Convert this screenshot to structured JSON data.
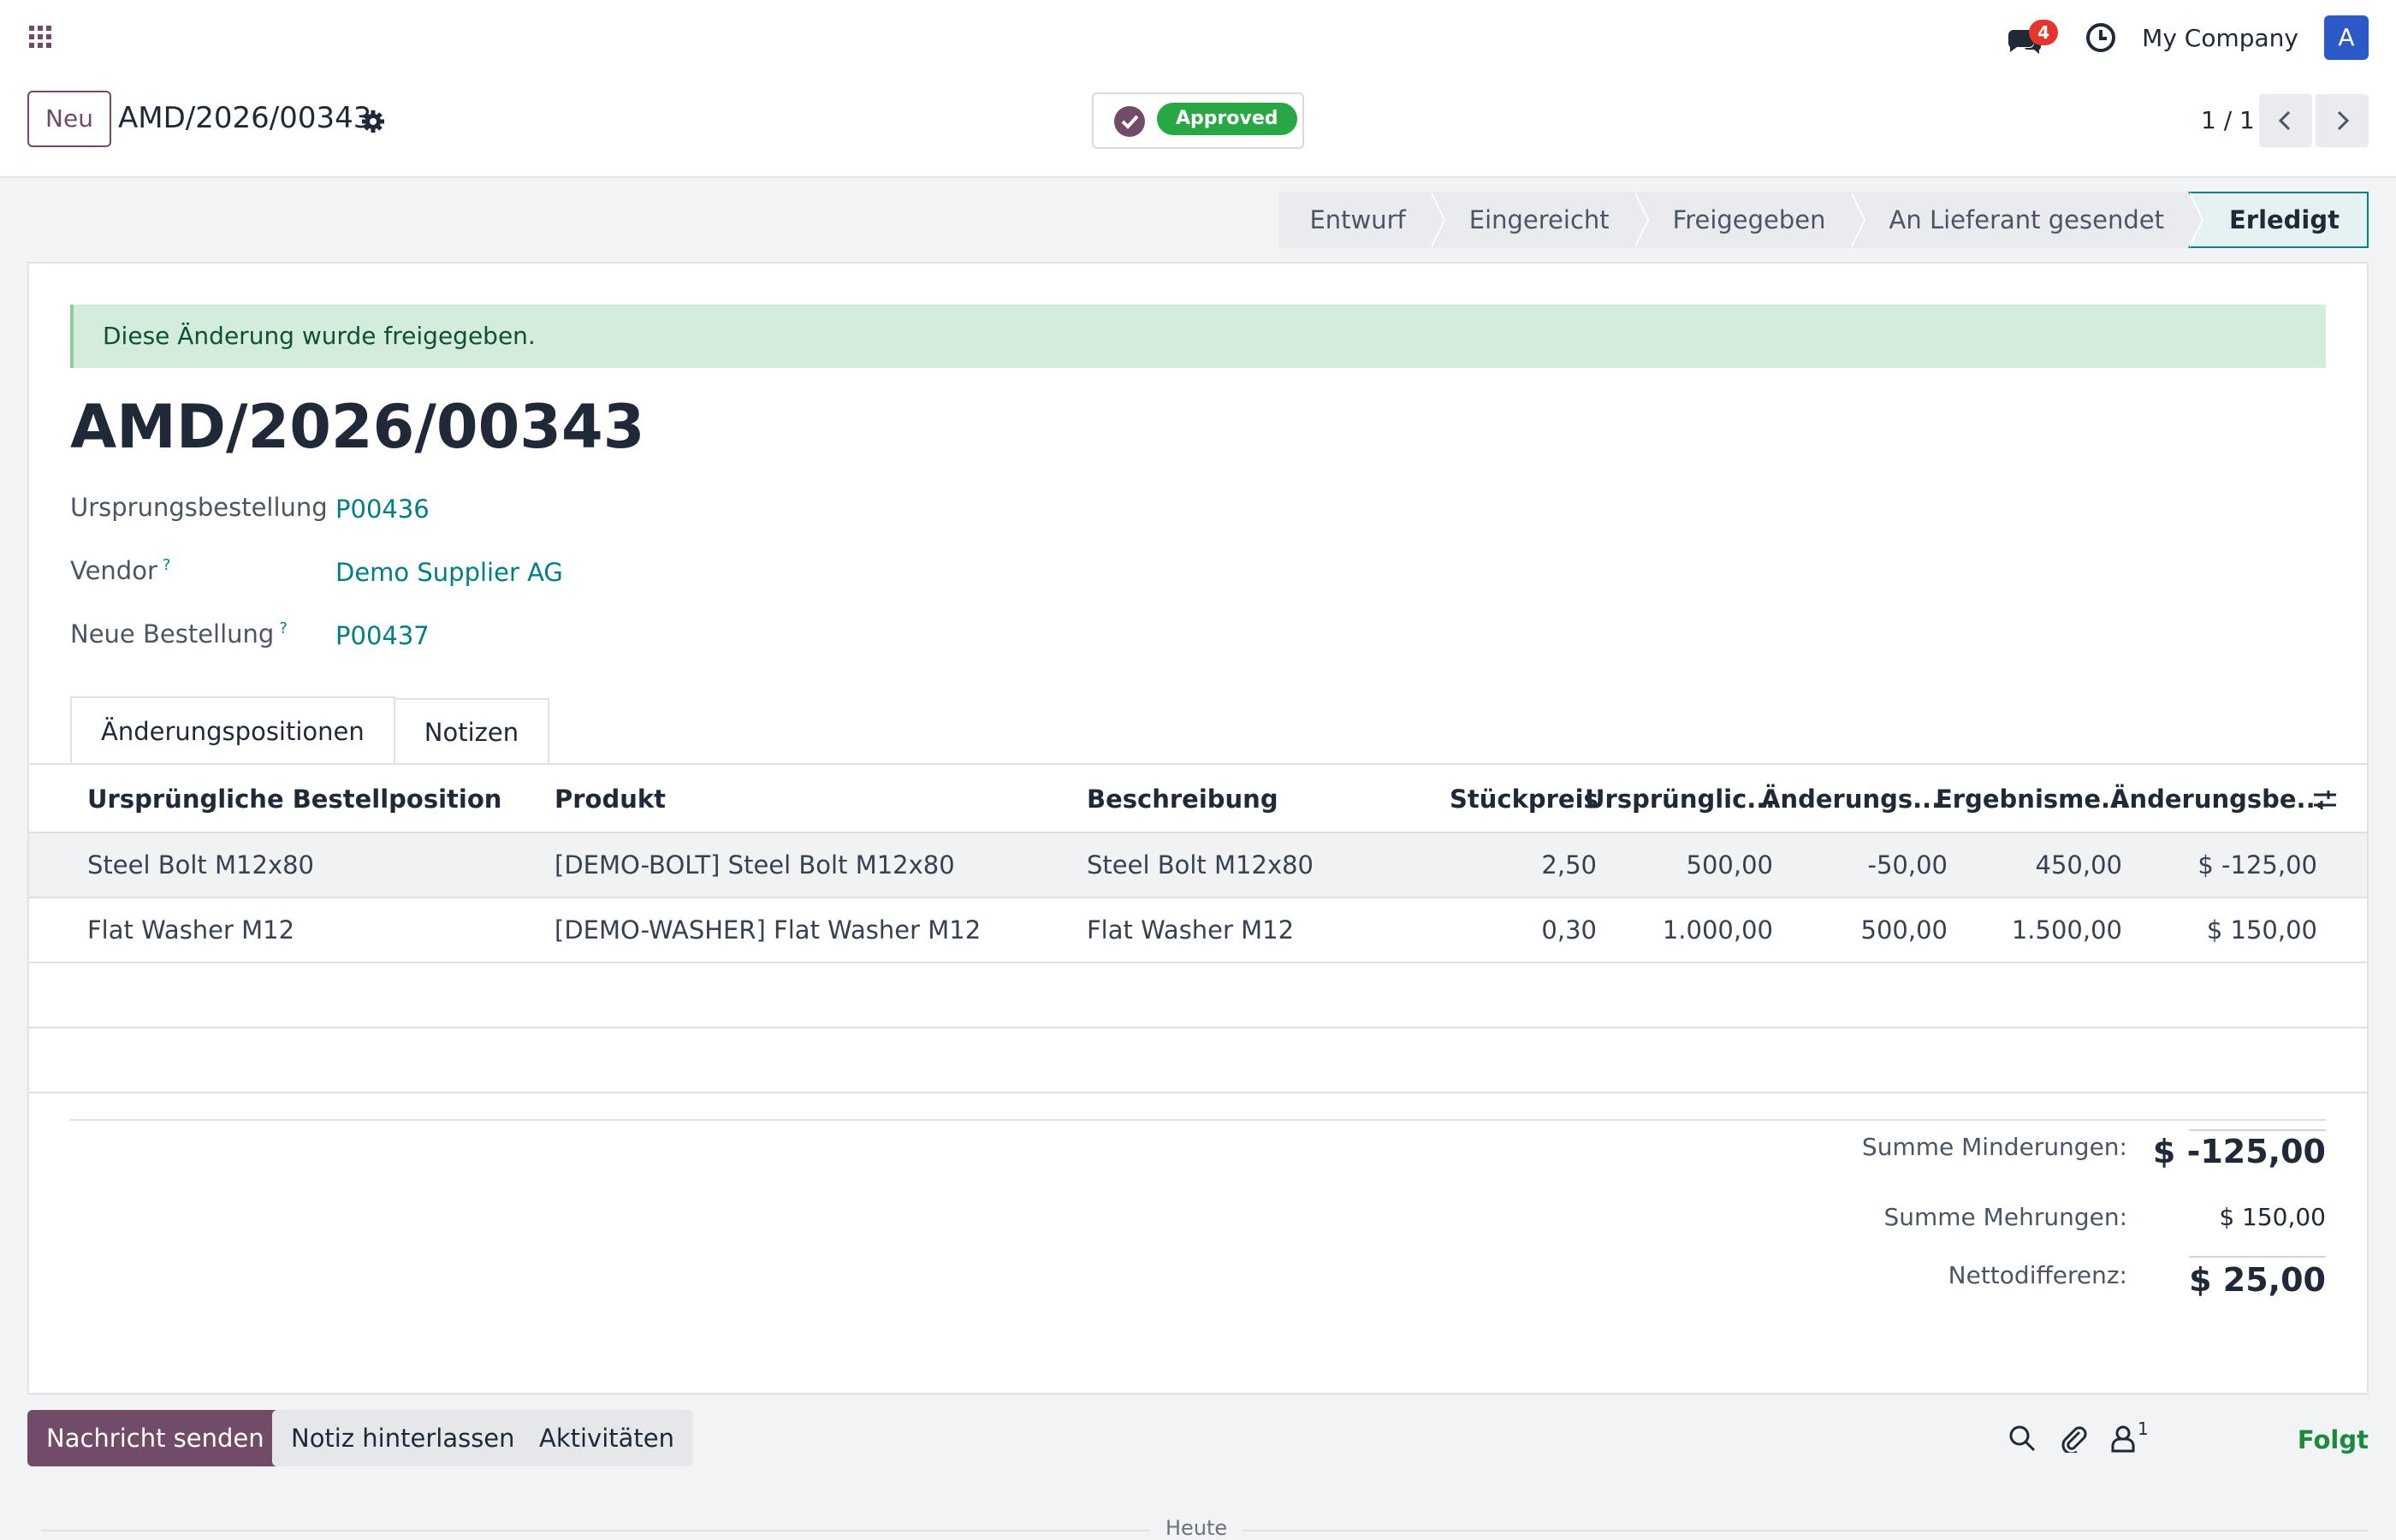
{
  "topbar": {
    "company": "My Company",
    "avatar_letter": "A",
    "message_count": "4",
    "icons": [
      "apps-grid-icon",
      "chat-icon",
      "clock-icon"
    ]
  },
  "control": {
    "new_label": "Neu",
    "record_name": "AMD/2026/00343",
    "status_label": "Approved",
    "pager": "1 / 1"
  },
  "stages": [
    {
      "label": "Entwurf",
      "active": false
    },
    {
      "label": "Eingereicht",
      "active": false
    },
    {
      "label": "Freigegeben",
      "active": false
    },
    {
      "label": "An Lieferant gesendet",
      "active": false
    },
    {
      "label": "Erledigt",
      "active": true
    }
  ],
  "form": {
    "alert": "Diese Änderung wurde freigegeben.",
    "title": "AMD/2026/00343",
    "fields": [
      {
        "label": "Ursprungsbestellung",
        "value": "P00436",
        "help": ""
      },
      {
        "label": "Vendor",
        "value": "Demo Supplier AG",
        "help": "?"
      },
      {
        "label": "Neue Bestellung",
        "value": "P00437",
        "help": "?"
      }
    ],
    "tabs": [
      "Änderungspositionen",
      "Notizen"
    ]
  },
  "table": {
    "headers": [
      "Ursprüngliche Bestellposition",
      "Produkt",
      "Beschreibung",
      "Stückpreis",
      "Ursprünglic...",
      "Änderungs...",
      "Ergebnisme...",
      "Änderungsbe..."
    ],
    "rows": [
      [
        "Steel Bolt M12x80",
        "[DEMO-BOLT] Steel Bolt M12x80",
        "Steel Bolt M12x80",
        "2,50",
        "500,00",
        "-50,00",
        "450,00",
        "$ -125,00"
      ],
      [
        "Flat Washer M12",
        "[DEMO-WASHER] Flat Washer M12",
        "Flat Washer M12",
        "0,30",
        "1.000,00",
        "500,00",
        "1.500,00",
        "$ 150,00"
      ]
    ]
  },
  "totals": {
    "decrease_label": "Summe Minderungen:",
    "decrease_value": "$ -125,00",
    "increase_label": "Summe Mehrungen:",
    "increase_value": "$ 150,00",
    "net_label": "Nettodifferenz:",
    "net_value": "$ 25,00"
  },
  "chatter": {
    "send": "Nachricht senden",
    "note": "Notiz hinterlassen",
    "activities": "Aktivitäten",
    "followers": "1",
    "follow": "Folgt",
    "today": "Heute"
  },
  "colors": {
    "brand": "#714b67",
    "link": "#017e84",
    "success": "#28a745",
    "badge": "#e4352f"
  }
}
